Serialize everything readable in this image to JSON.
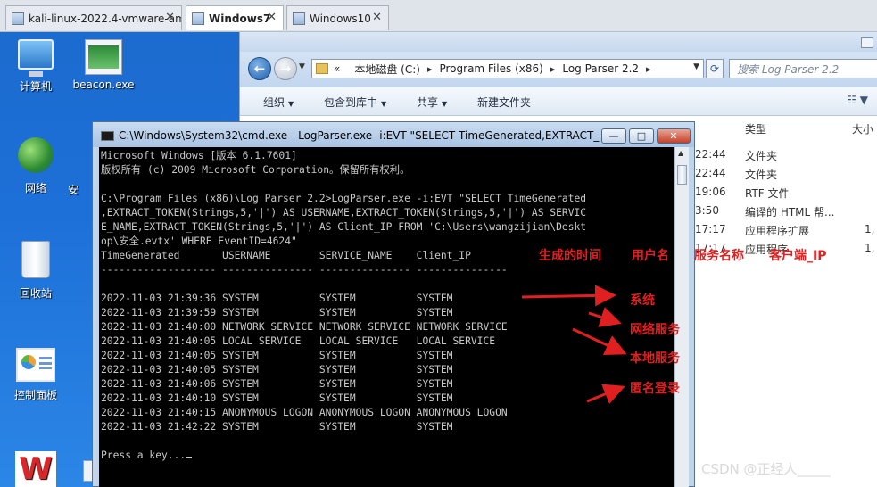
{
  "tabs": [
    {
      "label": "kali-linux-2022.4-vmware-am...",
      "active": false
    },
    {
      "label": "Windows7",
      "active": true
    },
    {
      "label": "Windows10",
      "active": false
    }
  ],
  "desktop_icons": [
    {
      "label": "计算机",
      "icon": "computer-icon"
    },
    {
      "label": "beacon.exe",
      "icon": "exe-icon"
    },
    {
      "label": "网络",
      "icon": "network-icon"
    },
    {
      "label": "安",
      "icon": "partial-icon"
    },
    {
      "label": "回收站",
      "icon": "recycle-bin-icon"
    },
    {
      "label": "控制面板",
      "icon": "control-panel-icon"
    }
  ],
  "explorer": {
    "address": {
      "prefix": "«",
      "crumbs": [
        "本地磁盘 (C:)",
        "Program Files (x86)",
        "Log Parser 2.2"
      ]
    },
    "search_placeholder": "搜索 Log Parser 2.2",
    "toolbar": {
      "organize": "组织",
      "include_in_library": "包含到库中",
      "share": "共享",
      "new_folder": "新建文件夹"
    },
    "columns": {
      "type": "类型",
      "size": "大小"
    },
    "rows": [
      {
        "time": "22:44",
        "type": "文件夹",
        "size": ""
      },
      {
        "time": "22:44",
        "type": "文件夹",
        "size": ""
      },
      {
        "time": "19:06",
        "type": "RTF 文件",
        "size": ""
      },
      {
        "time": "3:50",
        "type": "编译的 HTML 帮...",
        "size": ""
      },
      {
        "time": "17:17",
        "type": "应用程序扩展",
        "size": "1,"
      },
      {
        "time": "17:17",
        "type": "应用程序",
        "size": "1,"
      }
    ]
  },
  "cmd": {
    "title": "C:\\Windows\\System32\\cmd.exe - LogParser.exe  -i:EVT \"SELECT TimeGenerated,EXTRACT_...",
    "buttons": {
      "minimize": "—",
      "maximize": "□",
      "close": "✕"
    },
    "lines": [
      "Microsoft Windows [版本 6.1.7601]",
      "版权所有 (c) 2009 Microsoft Corporation。保留所有权利。",
      "",
      "C:\\Program Files (x86)\\Log Parser 2.2>LogParser.exe -i:EVT \"SELECT TimeGenerated",
      ",EXTRACT_TOKEN(Strings,5,'|') AS USERNAME,EXTRACT_TOKEN(Strings,5,'|') AS SERVIC",
      "E_NAME,EXTRACT_TOKEN(Strings,5,'|') AS Client_IP FROM 'C:\\Users\\wangzijian\\Deskt",
      "op\\安全.evtx' WHERE EventID=4624\"",
      "TimeGenerated       USERNAME        SERVICE_NAME    Client_IP",
      "------------------- --------------- --------------- ---------------",
      "",
      "2022-11-03 21:39:36 SYSTEM          SYSTEM          SYSTEM",
      "2022-11-03 21:39:59 SYSTEM          SYSTEM          SYSTEM",
      "2022-11-03 21:40:00 NETWORK SERVICE NETWORK SERVICE NETWORK SERVICE",
      "2022-11-03 21:40:05 LOCAL SERVICE   LOCAL SERVICE   LOCAL SERVICE",
      "2022-11-03 21:40:05 SYSTEM          SYSTEM          SYSTEM",
      "2022-11-03 21:40:05 SYSTEM          SYSTEM          SYSTEM",
      "2022-11-03 21:40:06 SYSTEM          SYSTEM          SYSTEM",
      "2022-11-03 21:40:10 SYSTEM          SYSTEM          SYSTEM",
      "2022-11-03 21:40:15 ANONYMOUS LOGON ANONYMOUS LOGON ANONYMOUS LOGON",
      "2022-11-03 21:42:22 SYSTEM          SYSTEM          SYSTEM",
      "",
      "Press a key..."
    ]
  },
  "annotations": {
    "header_labels": [
      "生成的时间",
      "用户名",
      "服务名称",
      "客户端_IP"
    ],
    "notes": [
      "系统",
      "网络服务",
      "本地服务",
      "匿名登录"
    ],
    "color": "#e02020"
  },
  "watermark": "CSDN @正经人_____"
}
